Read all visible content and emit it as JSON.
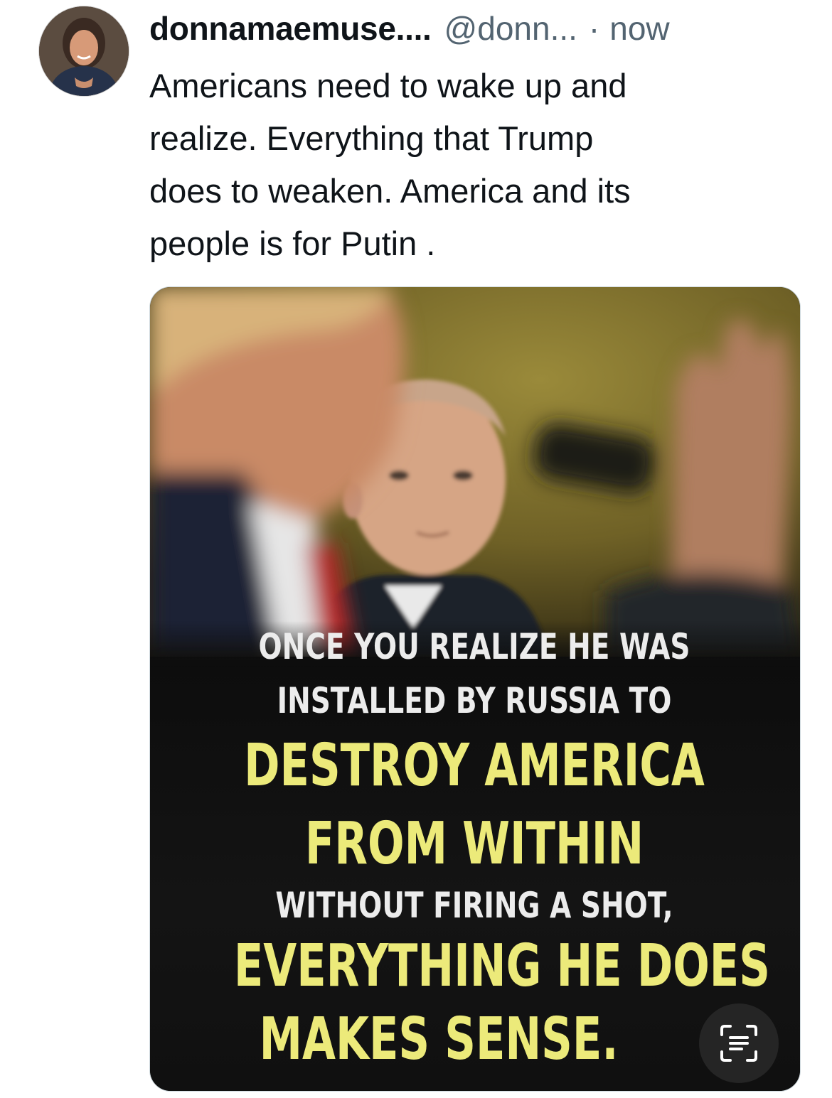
{
  "tweet": {
    "author": {
      "display_name": "donnamaemuse....",
      "handle": "@donn...",
      "avatar_icon": "profile-photo"
    },
    "separator": "·",
    "timestamp": "now",
    "text_lines": [
      "Americans need to wake up and",
      "realize. Everything that Trump",
      "does to weaken. America and its",
      "people is for Putin ."
    ]
  },
  "media": {
    "meme_lines": [
      "ONCE YOU REALIZE HE WAS",
      "INSTALLED BY RUSSIA TO",
      "DESTROY AMERICA",
      "FROM WITHIN",
      "WITHOUT FIRING A SHOT,",
      "EVERYTHING HE DOES",
      "MAKES SENSE."
    ],
    "colors": {
      "highlight": "#ecea7a",
      "white_text": "#ececec",
      "panel": "#141414"
    },
    "live_text_icon": "live-text-icon"
  },
  "colors": {
    "primary_text": "#0f1419",
    "secondary_text": "#536471"
  }
}
